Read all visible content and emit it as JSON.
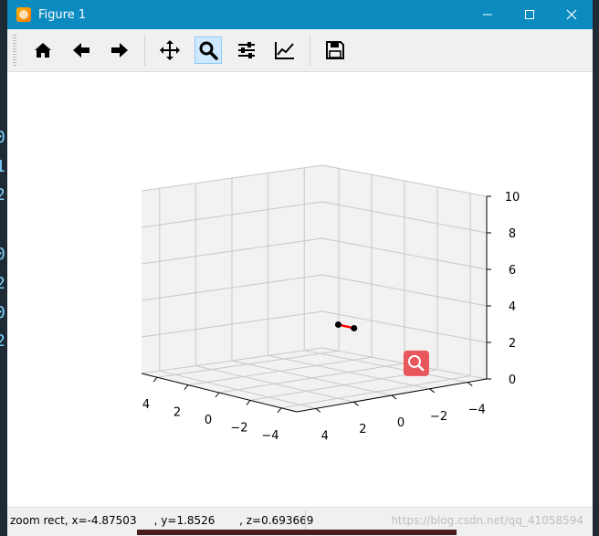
{
  "window": {
    "title": "Figure 1"
  },
  "toolbar": {
    "buttons": [
      {
        "name": "home-button",
        "icon": "home-icon"
      },
      {
        "name": "back-button",
        "icon": "arrow-left-icon"
      },
      {
        "name": "forward-button",
        "icon": "arrow-right-icon"
      },
      {
        "name": "pan-button",
        "icon": "move-icon"
      },
      {
        "name": "zoom-button",
        "icon": "magnifier-icon",
        "active": true
      },
      {
        "name": "subplots-button",
        "icon": "sliders-icon"
      },
      {
        "name": "edit-axes-button",
        "icon": "line-chart-icon"
      },
      {
        "name": "save-button",
        "icon": "save-icon"
      }
    ]
  },
  "status": {
    "text": "zoom rect, x=-4.87503     , y=1.8526       , z=0.693669",
    "watermark": "https://blog.csdn.net/qq_41058594"
  },
  "left_strip": [
    "0",
    "1",
    "2",
    "0",
    "2",
    "0",
    "2"
  ],
  "chart_data": {
    "type": "scatter",
    "projection": "3d",
    "x_ticks": [
      "4",
      "2",
      "0",
      "−2",
      "−4"
    ],
    "y_ticks": [
      "4",
      "2",
      "0",
      "−2",
      "−4"
    ],
    "z_ticks": [
      "0",
      "2",
      "4",
      "6",
      "8",
      "10"
    ],
    "xlim": [
      -5,
      5
    ],
    "ylim": [
      -5,
      5
    ],
    "zlim": [
      0,
      10
    ],
    "grid": true,
    "series": [
      {
        "points": [
          {
            "x": -4.9,
            "y": 1.9,
            "z": 4.0
          },
          {
            "x": -3.9,
            "y": 1.9,
            "z": 4.0
          }
        ],
        "marker_color": "#000000",
        "line_color": "#ff0000"
      }
    ],
    "overlay_icon": "zoom-magnifier-icon",
    "colors": {
      "pane": "#f2f2f2",
      "grid": "#c8c8c8",
      "line": "#ff0000",
      "marker": "#000000",
      "overlay": "#e8575b"
    }
  }
}
